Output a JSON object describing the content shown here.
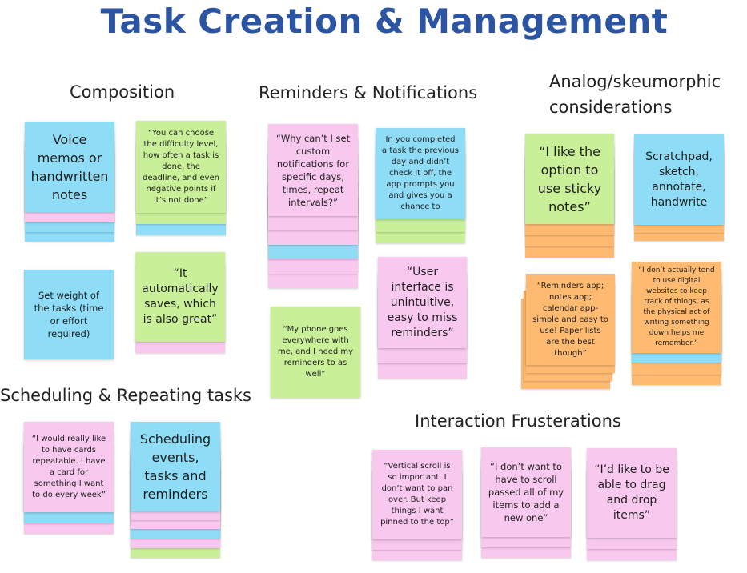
{
  "title": "Task Creation & Management",
  "sections": {
    "composition": "Composition",
    "reminders": "Reminders & Notifications",
    "analog_line1": "Analog/skeumorphic",
    "analog_line2": "considerations",
    "scheduling": "Scheduling & Repeating tasks",
    "interaction": "Interaction Frusterations"
  },
  "notes": {
    "voice_memos": "Voice memos or handwritten notes",
    "difficulty": "“You can choose the difficulty level, how often a task is done, the deadline, and even negative points if it’s not done”",
    "set_weight": "Set weight of the tasks (time or effort required)",
    "auto_saves": "“It automatically saves, which is also great”",
    "custom_notif": "“Why can’t I set custom notifications for specific days, times, repeat intervals?”",
    "prompt_check": "In you completed a task the previous day and didn’t check it off, the app prompts you and gives you a chance to",
    "phone_everywhere": "“My phone goes everywhere with me, and I need my reminders to as well”",
    "ui_unintuitive": "“User interface is unintuitive, easy to miss reminders”",
    "sticky_notes": "“I like the option to use sticky notes”",
    "scratchpad": "Scratchpad, sketch, annotate, handwrite",
    "reminders_app": "“Reminders app; notes app; calendar app- simple and easy to use! Paper lists are the best though”",
    "physical_act": "“I don’t actually tend to use digital websites to keep track of things, as the physical act of writing something down helps me remember.”",
    "repeatable": "“I would really like to have cards repeatable. I have a card for something I want to do every week”",
    "scheduling_events": "Scheduling events, tasks and reminders",
    "vertical_scroll": "“Vertical scroll is so important. I don’t want to pan over. But keep things I want pinned to the top”",
    "scroll_passed": "“I don’t want to have to scroll passed all of my items to add a new one”",
    "drag_drop": "“I’d like to be able to drag and drop items”"
  },
  "colors": {
    "title": "#2b54a3",
    "blue": "#8fdcf6",
    "pink": "#f8c8ef",
    "green": "#c9ef99",
    "orange": "#ffba72"
  }
}
